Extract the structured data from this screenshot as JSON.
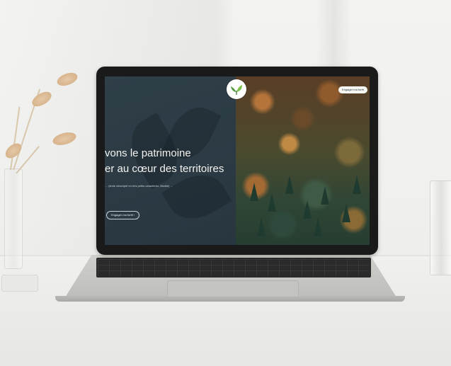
{
  "website": {
    "headline_line1": "vons le patrimoine",
    "headline_line2": "er au cœur des territoires",
    "paragraph": "… (texte descriptif en très petits caractères, illisible) …",
    "cta_label": "Engager ma forêt",
    "top_button_label": "Engager ma forêt"
  },
  "colors": {
    "panel": "#2b3a43",
    "logo_green": "#4c9a3a"
  },
  "icons": {
    "logo": "leaf-logo-icon",
    "cta_arrow": "arrow-right-icon"
  }
}
